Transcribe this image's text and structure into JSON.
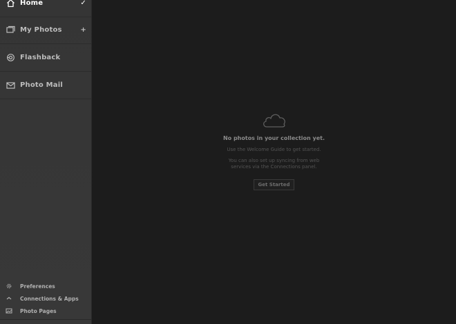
{
  "sidebar": {
    "items": [
      {
        "label": "Home",
        "icon": "home-icon",
        "right": "✓",
        "active": true
      },
      {
        "label": "My Photos",
        "icon": "photos-icon",
        "right": "+"
      },
      {
        "label": "Flashback",
        "icon": "flashback-icon",
        "right": ""
      },
      {
        "label": "Photo Mail",
        "icon": "mail-icon",
        "right": ""
      }
    ],
    "bottom_links": [
      {
        "label": "Preferences",
        "icon": "gear-icon"
      },
      {
        "label": "Connections & Apps",
        "icon": "connections-icon"
      },
      {
        "label": "Photo Pages",
        "icon": "photo-pages-icon"
      }
    ]
  },
  "main": {
    "empty_state": {
      "title": "No photos in your collection yet.",
      "line1": "Use the Welcome Guide to get started.",
      "line2": "You can also set up syncing from web services via the Connections panel.",
      "button": "Get Started"
    }
  },
  "colors": {
    "sidebar_bg": "#363636",
    "main_bg": "#1c1c1c",
    "active_text": "#ffffff",
    "text": "#bdbdbd"
  }
}
